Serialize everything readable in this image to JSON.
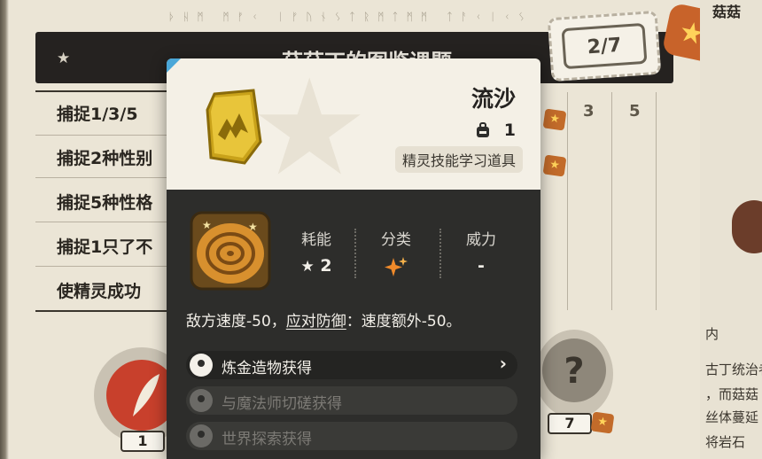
{
  "background": {
    "rune_strip": "ᚦᚺᛗ ᛗᚠᚲ ᛁᚠᚢᚾᛊᛏᚱᛗᛏᛗᛗ ᛏᚨᚲᛁᚲᛊ",
    "banner_title": "菇菇丁的图鉴课题",
    "tasks": [
      "捕捉1/3/5",
      "捕捉2种性别",
      "捕捉5种性格",
      "捕捉1只了不",
      "使精灵成功"
    ],
    "column_numbers": [
      "3",
      "5"
    ],
    "progress": "2/7",
    "corner_tag": "菇菇",
    "right_text": [
      "内",
      "古丁统治者",
      "，而菇菇",
      "丝体蔓延",
      "将岩石"
    ],
    "medals": [
      {
        "count": "1"
      },
      {
        "count": "7"
      }
    ]
  },
  "popup": {
    "item_name": "流沙",
    "bag_count": "1",
    "item_type": "精灵技能学习道具",
    "stats": [
      {
        "label": "耗能",
        "value": "2",
        "icon": "star-icon"
      },
      {
        "label": "分类",
        "value": "",
        "icon": "sparkle-icon"
      },
      {
        "label": "威力",
        "value": "-"
      }
    ],
    "description": {
      "part1": "敌方速度-50，",
      "keyword": "应对防御",
      "part2": "：速度额外-50。"
    },
    "sources": [
      {
        "label": "炼金造物获得",
        "active": true
      },
      {
        "label": "与魔法师切磋获得",
        "active": false
      },
      {
        "label": "世界探索获得",
        "active": false
      }
    ]
  },
  "colors": {
    "popup_bg": "#2d2d2b",
    "popup_header_bg": "#f4f0e6",
    "accent_blue": "#4aa7d8",
    "badge_orange": "#c26b2a",
    "sparkle_orange": "#f08a2a"
  }
}
